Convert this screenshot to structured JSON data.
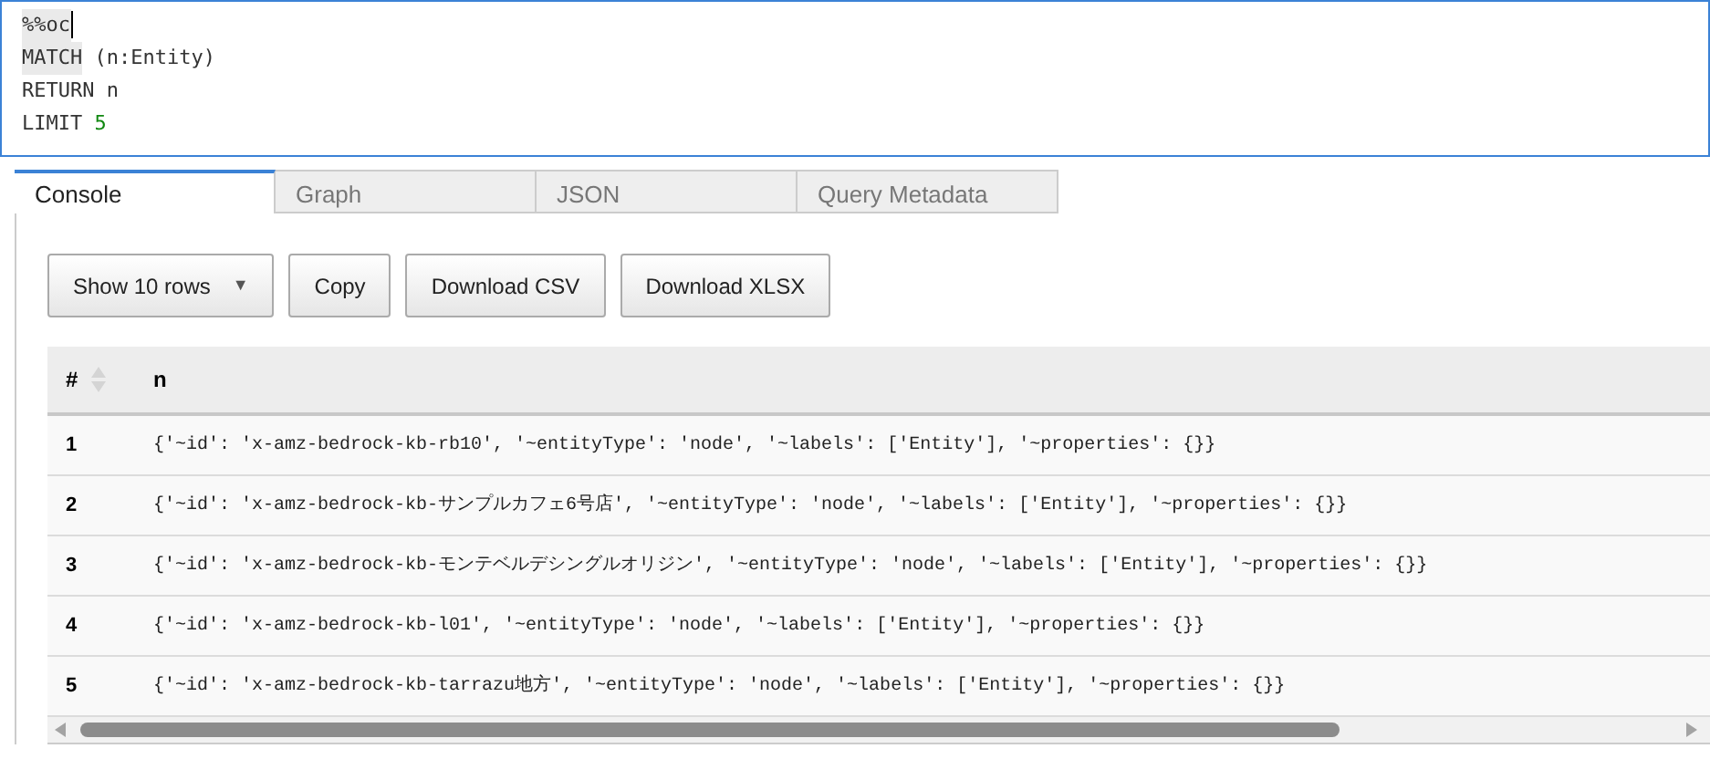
{
  "editor": {
    "lines": [
      [
        {
          "text": "%%oc",
          "kind": "magic"
        }
      ],
      [
        {
          "text": "MATCH",
          "kind": "keyword"
        },
        {
          "text": " (n:Entity)",
          "kind": "plain"
        }
      ],
      [
        {
          "text": "RETURN n",
          "kind": "plain"
        }
      ],
      [
        {
          "text": "LIMIT ",
          "kind": "plain"
        },
        {
          "text": "5",
          "kind": "number"
        }
      ]
    ]
  },
  "tabs": [
    {
      "label": "Console",
      "selected": true
    },
    {
      "label": "Graph",
      "selected": false
    },
    {
      "label": "JSON",
      "selected": false
    },
    {
      "label": "Query Metadata",
      "selected": false
    }
  ],
  "toolbar": {
    "page_length": "Show 10 rows",
    "page_length_caret": "▼",
    "buttons": [
      "Copy",
      "Download CSV",
      "Download XLSX"
    ]
  },
  "table": {
    "columns": [
      "#",
      "n"
    ],
    "rows": [
      [
        "1",
        "{'~id': 'x-amz-bedrock-kb-rb10', '~entityType': 'node', '~labels': ['Entity'], '~properties': {}}"
      ],
      [
        "2",
        "{'~id': 'x-amz-bedrock-kb-サンプルカフェ6号店', '~entityType': 'node', '~labels': ['Entity'], '~properties': {}}"
      ],
      [
        "3",
        "{'~id': 'x-amz-bedrock-kb-モンテベルデシングルオリジン', '~entityType': 'node', '~labels': ['Entity'], '~properties': {}}"
      ],
      [
        "4",
        "{'~id': 'x-amz-bedrock-kb-l01', '~entityType': 'node', '~labels': ['Entity'], '~properties': {}}"
      ],
      [
        "5",
        "{'~id': 'x-amz-bedrock-kb-tarrazu地方', '~entityType': 'node', '~labels': ['Entity'], '~properties': {}}"
      ]
    ]
  }
}
